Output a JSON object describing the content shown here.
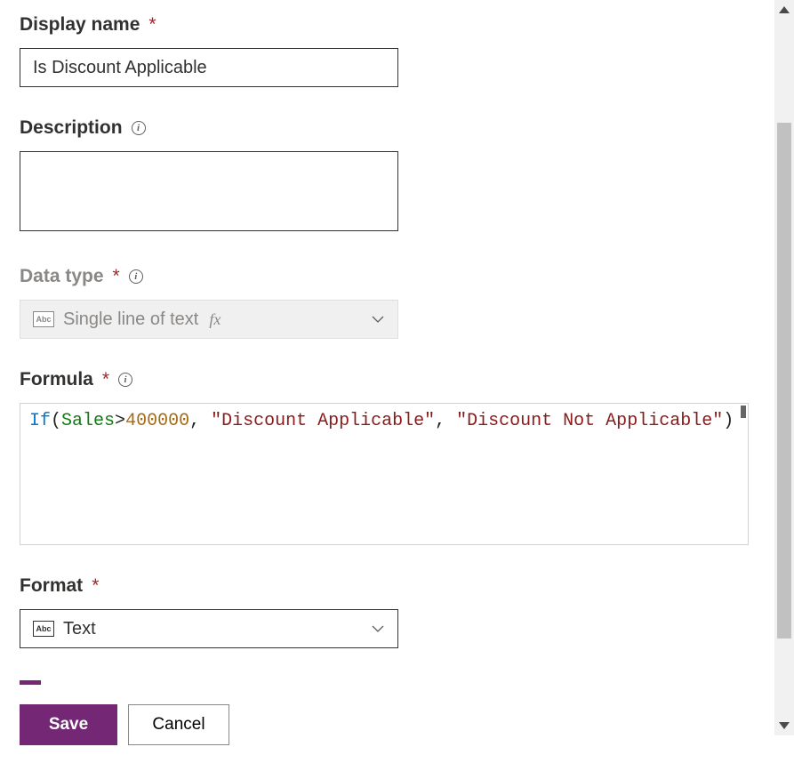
{
  "fields": {
    "displayName": {
      "label": "Display name",
      "value": "Is Discount Applicable"
    },
    "description": {
      "label": "Description",
      "value": ""
    },
    "dataType": {
      "label": "Data type",
      "value": "Single line of text"
    },
    "formula": {
      "label": "Formula"
    },
    "format": {
      "label": "Format",
      "value": "Text"
    }
  },
  "formula_tokens": {
    "fn": "If",
    "open": "(",
    "field": "Sales",
    "op": ">",
    "num": "400000",
    "c1": ", ",
    "s1": "\"Discount Applicable\"",
    "c2": ", ",
    "s2": "\"Discount Not Applicable\"",
    "close": ")"
  },
  "buttons": {
    "save": "Save",
    "cancel": "Cancel"
  },
  "icons": {
    "abc": "Abc"
  }
}
